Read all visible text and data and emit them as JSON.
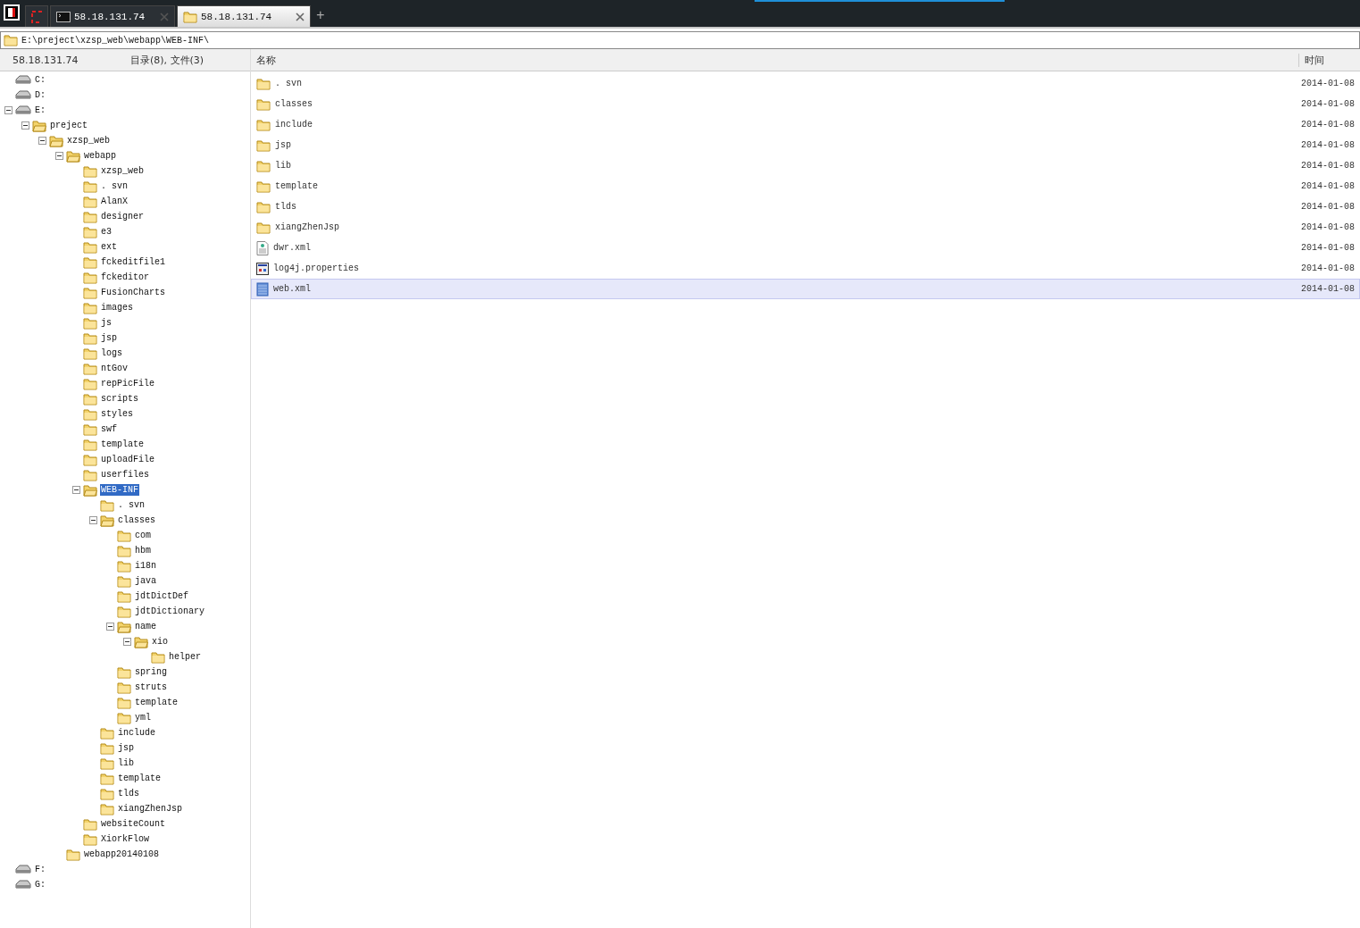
{
  "tabs": [
    {
      "kind": "blank",
      "selected": false
    },
    {
      "kind": "terminal",
      "label": "58.18.131.74",
      "selected": false
    },
    {
      "kind": "folder",
      "label": "58.18.131.74",
      "selected": true
    }
  ],
  "new_tab": "+",
  "path": "E:\\preject\\xzsp_web\\webapp\\WEB-INF\\",
  "left_header": {
    "host": "58.18.131.74",
    "summary": "目录(8), 文件(3)"
  },
  "tree": [
    {
      "name": "C:",
      "kind": "drive",
      "expanded": false,
      "selected": false
    },
    {
      "name": "D:",
      "kind": "drive",
      "expanded": false,
      "selected": false
    },
    {
      "name": "E:",
      "kind": "drive",
      "expanded": true,
      "selected": false,
      "children": [
        {
          "name": "preject",
          "kind": "folder",
          "expanded": true,
          "selected": false,
          "children": [
            {
              "name": "xzsp_web",
              "kind": "folder",
              "expanded": true,
              "selected": false,
              "children": [
                {
                  "name": "webapp",
                  "kind": "folder",
                  "expanded": true,
                  "selected": false,
                  "children": [
                    {
                      "name": "xzsp_web",
                      "kind": "folder",
                      "expanded": false,
                      "selected": false
                    },
                    {
                      "name": ". svn",
                      "kind": "folder",
                      "expanded": false,
                      "selected": false
                    },
                    {
                      "name": "AlanX",
                      "kind": "folder",
                      "expanded": false,
                      "selected": false
                    },
                    {
                      "name": "designer",
                      "kind": "folder",
                      "expanded": false,
                      "selected": false
                    },
                    {
                      "name": "e3",
                      "kind": "folder",
                      "expanded": false,
                      "selected": false
                    },
                    {
                      "name": "ext",
                      "kind": "folder",
                      "expanded": false,
                      "selected": false
                    },
                    {
                      "name": "fckeditfile1",
                      "kind": "folder",
                      "expanded": false,
                      "selected": false
                    },
                    {
                      "name": "fckeditor",
                      "kind": "folder",
                      "expanded": false,
                      "selected": false
                    },
                    {
                      "name": "FusionCharts",
                      "kind": "folder",
                      "expanded": false,
                      "selected": false
                    },
                    {
                      "name": "images",
                      "kind": "folder",
                      "expanded": false,
                      "selected": false
                    },
                    {
                      "name": "js",
                      "kind": "folder",
                      "expanded": false,
                      "selected": false
                    },
                    {
                      "name": "jsp",
                      "kind": "folder",
                      "expanded": false,
                      "selected": false
                    },
                    {
                      "name": "logs",
                      "kind": "folder",
                      "expanded": false,
                      "selected": false
                    },
                    {
                      "name": "ntGov",
                      "kind": "folder",
                      "expanded": false,
                      "selected": false
                    },
                    {
                      "name": "repPicFile",
                      "kind": "folder",
                      "expanded": false,
                      "selected": false
                    },
                    {
                      "name": "scripts",
                      "kind": "folder",
                      "expanded": false,
                      "selected": false
                    },
                    {
                      "name": "styles",
                      "kind": "folder",
                      "expanded": false,
                      "selected": false
                    },
                    {
                      "name": "swf",
                      "kind": "folder",
                      "expanded": false,
                      "selected": false
                    },
                    {
                      "name": "template",
                      "kind": "folder",
                      "expanded": false,
                      "selected": false
                    },
                    {
                      "name": "uploadFile",
                      "kind": "folder",
                      "expanded": false,
                      "selected": false
                    },
                    {
                      "name": "userfiles",
                      "kind": "folder",
                      "expanded": false,
                      "selected": false
                    },
                    {
                      "name": "WEB-INF",
                      "kind": "folder",
                      "expanded": true,
                      "selected": true,
                      "children": [
                        {
                          "name": ". svn",
                          "kind": "folder",
                          "expanded": false,
                          "selected": false
                        },
                        {
                          "name": "classes",
                          "kind": "folder",
                          "expanded": true,
                          "selected": false,
                          "children": [
                            {
                              "name": "com",
                              "kind": "folder",
                              "expanded": false,
                              "selected": false
                            },
                            {
                              "name": "hbm",
                              "kind": "folder",
                              "expanded": false,
                              "selected": false
                            },
                            {
                              "name": "i18n",
                              "kind": "folder",
                              "expanded": false,
                              "selected": false
                            },
                            {
                              "name": "java",
                              "kind": "folder",
                              "expanded": false,
                              "selected": false
                            },
                            {
                              "name": "jdtDictDef",
                              "kind": "folder",
                              "expanded": false,
                              "selected": false
                            },
                            {
                              "name": "jdtDictionary",
                              "kind": "folder",
                              "expanded": false,
                              "selected": false
                            },
                            {
                              "name": "name",
                              "kind": "folder",
                              "expanded": true,
                              "selected": false,
                              "children": [
                                {
                                  "name": "xio",
                                  "kind": "folder",
                                  "expanded": true,
                                  "selected": false,
                                  "children": [
                                    {
                                      "name": "helper",
                                      "kind": "folder",
                                      "expanded": false,
                                      "selected": false
                                    }
                                  ]
                                }
                              ]
                            },
                            {
                              "name": "spring",
                              "kind": "folder",
                              "expanded": false,
                              "selected": false
                            },
                            {
                              "name": "struts",
                              "kind": "folder",
                              "expanded": false,
                              "selected": false
                            },
                            {
                              "name": "template",
                              "kind": "folder",
                              "expanded": false,
                              "selected": false
                            },
                            {
                              "name": "yml",
                              "kind": "folder",
                              "expanded": false,
                              "selected": false
                            }
                          ]
                        },
                        {
                          "name": "include",
                          "kind": "folder",
                          "expanded": false,
                          "selected": false
                        },
                        {
                          "name": "jsp",
                          "kind": "folder",
                          "expanded": false,
                          "selected": false
                        },
                        {
                          "name": "lib",
                          "kind": "folder",
                          "expanded": false,
                          "selected": false
                        },
                        {
                          "name": "template",
                          "kind": "folder",
                          "expanded": false,
                          "selected": false
                        },
                        {
                          "name": "tlds",
                          "kind": "folder",
                          "expanded": false,
                          "selected": false
                        },
                        {
                          "name": "xiangZhenJsp",
                          "kind": "folder",
                          "expanded": false,
                          "selected": false
                        }
                      ]
                    },
                    {
                      "name": "websiteCount",
                      "kind": "folder",
                      "expanded": false,
                      "selected": false
                    },
                    {
                      "name": "XiorkFlow",
                      "kind": "folder",
                      "expanded": false,
                      "selected": false
                    }
                  ]
                },
                {
                  "name": "webapp20140108",
                  "kind": "folder",
                  "expanded": false,
                  "selected": false
                }
              ]
            }
          ]
        }
      ]
    },
    {
      "name": "F:",
      "kind": "drive",
      "expanded": false,
      "selected": false
    },
    {
      "name": "G:",
      "kind": "drive",
      "expanded": false,
      "selected": false
    }
  ],
  "table": {
    "columns": [
      "名称",
      "时间"
    ],
    "rows": [
      {
        "name": ". svn",
        "kind": "folder",
        "time": "2014-01-08",
        "selected": false
      },
      {
        "name": "classes",
        "kind": "folder",
        "time": "2014-01-08",
        "selected": false
      },
      {
        "name": "include",
        "kind": "folder",
        "time": "2014-01-08",
        "selected": false
      },
      {
        "name": "jsp",
        "kind": "folder",
        "time": "2014-01-08",
        "selected": false
      },
      {
        "name": "lib",
        "kind": "folder",
        "time": "2014-01-08",
        "selected": false
      },
      {
        "name": "template",
        "kind": "folder",
        "time": "2014-01-08",
        "selected": false
      },
      {
        "name": "tlds",
        "kind": "folder",
        "time": "2014-01-08",
        "selected": false
      },
      {
        "name": "xiangZhenJsp",
        "kind": "folder",
        "time": "2014-01-08",
        "selected": false
      },
      {
        "name": "dwr.xml",
        "kind": "document",
        "time": "2014-01-08",
        "selected": false
      },
      {
        "name": "log4j.properties",
        "kind": "settings",
        "time": "2014-01-08",
        "selected": false
      },
      {
        "name": "web.xml",
        "kind": "xml",
        "time": "2014-01-08",
        "selected": true
      }
    ]
  }
}
